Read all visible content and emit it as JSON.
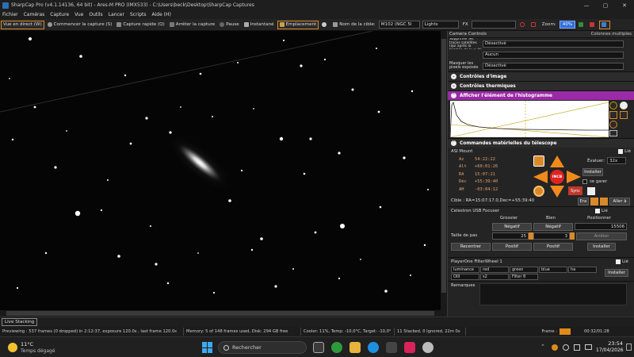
{
  "window": {
    "title": "SharpCap Pro (v4.1.14136, 64 bit) - Ares-M PRO (IMX533) - C:\\Users\\beck\\Desktop\\SharpCap Captures",
    "controls": [
      "—",
      "▢",
      "✕"
    ]
  },
  "menu": [
    "Fichier",
    "Caméras",
    "Capture",
    "Vue",
    "Outils",
    "Lancer",
    "Scripts",
    "Aide (H)"
  ],
  "toolbar": {
    "live": "Vue en direct (W)",
    "start_capture": "Commencer la capture (S)",
    "quick_capture": "Capture rapide (Q)",
    "stop_capture": "Arrêter la capture",
    "pause": "Pause",
    "snapshot": "Instantané",
    "location": "Emplacement",
    "target_label": "Nom de la cible:",
    "target_value": "M102 (NGC 5I",
    "frame_type": "Lights",
    "fx_label": "FX",
    "zoom_label": "Zoom:",
    "zoom_value": "40%"
  },
  "panel": {
    "header": "Camera Controls",
    "multi_columns": "Colonnes multiples",
    "rows": [
      {
        "label": "Supprimer les traces satellites (qui après la tombée de la nuit)",
        "value": "Désactivé"
      },
      {
        "label": "",
        "value": "Aucun"
      },
      {
        "label": "Masquer les pixels exposés",
        "value": "Désactivé"
      }
    ],
    "sections": {
      "image_controls": "Contrôles d'image",
      "thermal_controls": "Contrôles thermiques",
      "histogram": "Afficher l'élément de l'histogramme",
      "telescope": "Commandes matérielles du télescope"
    },
    "mount": {
      "name": "ASI Mount",
      "connected": "Lié",
      "coords": [
        {
          "k": "Az",
          "v": "54:22:22"
        },
        {
          "k": "Alt",
          "v": "+60:01:26"
        },
        {
          "k": "RA",
          "v": "15:07:21"
        },
        {
          "k": "Déc",
          "v": "+55:39:40"
        },
        {
          "k": "AH",
          "v": "-03:04:12"
        }
      ],
      "evaluate_label": "Évaluer:",
      "evaluate_value": "32x",
      "install": "Installer",
      "park": "se garer",
      "center": "INCB",
      "sync": "Sync",
      "target": "Cible : RA=15:07:17.0,Dec=+55:39:40",
      "in": "Ens",
      "goto": "Aller à"
    },
    "focuser": {
      "name": "Celestron USB Focuser",
      "connected": "Lié",
      "headers": [
        "Grossier",
        "Bien",
        "Positionner"
      ],
      "neg": "Négatif",
      "pos": "Positif",
      "position": "15506",
      "stop": "Arrêter",
      "step_label": "Taille de pas",
      "step_coarse": "25",
      "step_fine": "3",
      "retract": "Recentrer",
      "install": "Installer"
    },
    "filterwheel": {
      "name": "PlayerOne FilterWheel 1",
      "connected": "Lié",
      "filters": [
        "luminance",
        "red",
        "green",
        "blue",
        "ha",
        "OIII",
        "s2",
        "Filter 8"
      ],
      "install": "Installer"
    },
    "remarks": "Remarques"
  },
  "status": {
    "live_stacking": "Live Stacking",
    "frame_label": "Frame :",
    "elapsed": "00:32/01:28",
    "info": [
      "Previewing : 537 frames (0 dropped) in 2:12:37, exposure 120.0s , last frame 120.0s",
      "Memory: 5 of 148 frames used, Disk: 294 GB free",
      "Cooler: 11%, Temp: -10,0°C, Target: -10,0°",
      "11 Stacked, 0 Ignored, 22m 0s"
    ]
  },
  "taskbar": {
    "weather_temp": "11°C",
    "weather_desc": "Temps dégagé",
    "search": "Rechercher",
    "time": "23:54",
    "date": "17/04/2026"
  },
  "colors": {
    "accent": "#d88a2a",
    "section_purple": "#9a2aa5",
    "zoom_blue": "#2f6fdb"
  }
}
